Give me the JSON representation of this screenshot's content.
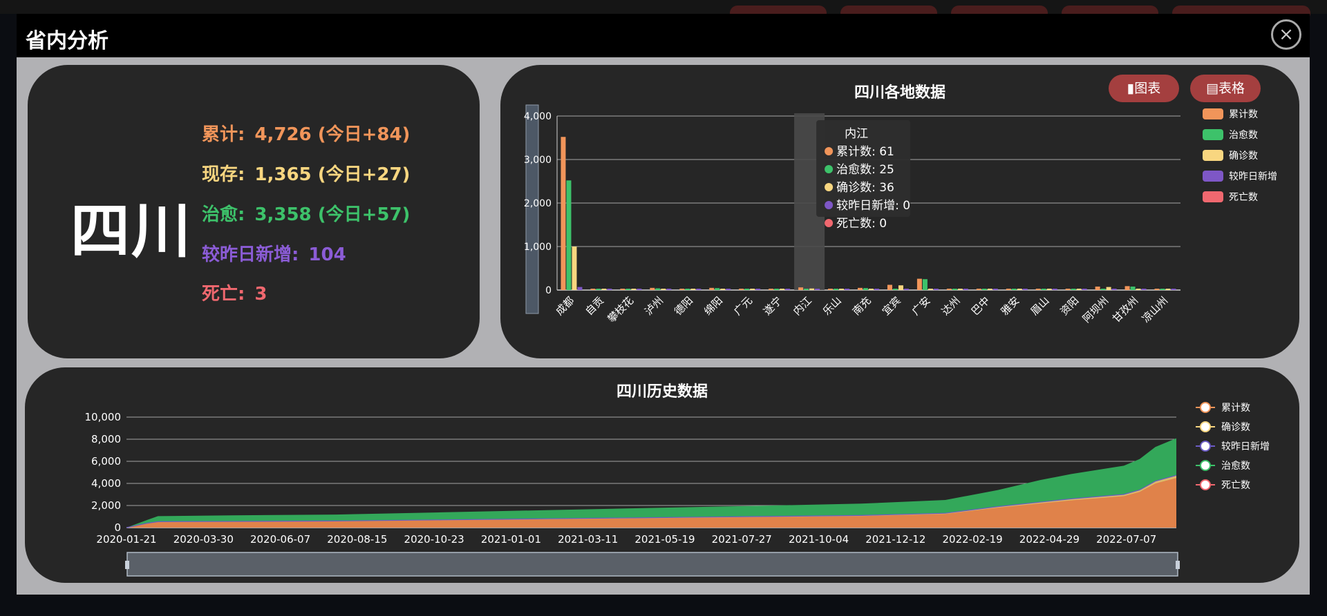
{
  "modal": {
    "title": "省内分析"
  },
  "summary": {
    "province": "四川",
    "stats": [
      {
        "label": "累计:",
        "value": "4,726 (今日+84)",
        "color": "#f1955a"
      },
      {
        "label": "现存:",
        "value": "1,365 (今日+27)",
        "color": "#f8d680"
      },
      {
        "label": "治愈:",
        "value": "3,358 (今日+57)",
        "color": "#3dc26a"
      },
      {
        "label": "较昨日新增:",
        "value": "104",
        "color": "#8b5cd6"
      },
      {
        "label": "死亡:",
        "value": "3",
        "color": "#f0686f"
      }
    ]
  },
  "buttons": {
    "chart": "图表",
    "table": "表格"
  },
  "chart_data": [
    {
      "type": "bar",
      "title": "四川各地数据",
      "categories": [
        "成都",
        "自贡",
        "攀枝花",
        "泸州",
        "德阳",
        "绵阳",
        "广元",
        "遂宁",
        "内江",
        "乐山",
        "南充",
        "宜宾",
        "广安",
        "达州",
        "巴中",
        "雅安",
        "眉山",
        "资阳",
        "阿坝州",
        "甘孜州",
        "凉山州"
      ],
      "series": [
        {
          "name": "累计数",
          "color": "#f1955a",
          "values": [
            3520,
            10,
            16,
            50,
            25,
            50,
            12,
            30,
            61,
            5,
            50,
            120,
            260,
            30,
            25,
            6,
            25,
            30,
            80,
            90,
            30
          ]
        },
        {
          "name": "治愈数",
          "color": "#3dc26a",
          "values": [
            2520,
            6,
            10,
            40,
            20,
            45,
            10,
            25,
            25,
            4,
            45,
            12,
            250,
            25,
            20,
            5,
            20,
            25,
            10,
            80,
            25
          ]
        },
        {
          "name": "确诊数",
          "color": "#f8d680",
          "values": [
            1000,
            4,
            6,
            10,
            5,
            5,
            2,
            5,
            36,
            1,
            5,
            108,
            10,
            5,
            5,
            1,
            5,
            5,
            70,
            10,
            5
          ]
        },
        {
          "name": "较昨日新增",
          "color": "#7e57c6",
          "values": [
            70,
            0,
            0,
            0,
            0,
            0,
            0,
            0,
            0,
            0,
            0,
            0,
            0,
            0,
            0,
            0,
            0,
            0,
            0,
            0,
            0
          ]
        },
        {
          "name": "死亡数",
          "color": "#f0686f",
          "values": [
            0,
            0,
            0,
            0,
            0,
            0,
            0,
            0,
            0,
            0,
            0,
            0,
            0,
            0,
            0,
            0,
            0,
            0,
            0,
            0,
            0
          ]
        }
      ],
      "yticks": [
        "0",
        "1,000",
        "2,000",
        "3,000",
        "4,000"
      ],
      "ylim": [
        0,
        4000
      ],
      "grid": true,
      "legend_position": "right",
      "tooltip": {
        "title": "内江",
        "lines": [
          "累计数: 61",
          "治愈数: 25",
          "确诊数: 36",
          "较昨日新增: 0",
          "死亡数: 0"
        ],
        "category_index": 8
      }
    },
    {
      "type": "area",
      "title": "四川历史数据",
      "series_names": [
        "累计数",
        "确诊数",
        "较昨日新增",
        "治愈数",
        "死亡数"
      ],
      "colors": {
        "cumulative": "#e0824a",
        "confirmed": "#ddba6a",
        "cured": "#33a85a",
        "new": "#6b5bc4"
      },
      "xticks": [
        "2020-01-21",
        "2020-03-30",
        "2020-06-07",
        "2020-08-15",
        "2020-10-23",
        "2021-01-01",
        "2021-03-11",
        "2021-05-19",
        "2021-07-27",
        "2021-10-04",
        "2021-12-12",
        "2022-02-19",
        "2022-04-29",
        "2022-07-07"
      ],
      "yticks": [
        "0",
        "2,000",
        "4,000",
        "6,000",
        "8,000",
        "10,000"
      ],
      "ylim": [
        0,
        10000
      ],
      "points": [
        {
          "t": 0,
          "cum": 0,
          "cured": 0
        },
        {
          "t": 0.02,
          "cum": 400,
          "cured": 300
        },
        {
          "t": 0.03,
          "cum": 540,
          "cured": 500
        },
        {
          "t": 0.1,
          "cum": 560,
          "cured": 550
        },
        {
          "t": 0.2,
          "cum": 600,
          "cured": 580
        },
        {
          "t": 0.3,
          "cum": 700,
          "cured": 680
        },
        {
          "t": 0.4,
          "cum": 800,
          "cured": 780
        },
        {
          "t": 0.5,
          "cum": 900,
          "cured": 880
        },
        {
          "t": 0.6,
          "cum": 1000,
          "cured": 970
        },
        {
          "t": 0.7,
          "cum": 1100,
          "cured": 1070
        },
        {
          "t": 0.78,
          "cum": 1300,
          "cured": 1200
        },
        {
          "t": 0.83,
          "cum": 1900,
          "cured": 1500
        },
        {
          "t": 0.87,
          "cum": 2300,
          "cured": 2000
        },
        {
          "t": 0.9,
          "cum": 2600,
          "cured": 2250
        },
        {
          "t": 0.95,
          "cum": 3000,
          "cured": 2600
        },
        {
          "t": 0.965,
          "cum": 3400,
          "cured": 2800
        },
        {
          "t": 0.98,
          "cum": 4200,
          "cured": 3100
        },
        {
          "t": 1.0,
          "cum": 4726,
          "cured": 3358
        }
      ],
      "legend_position": "right"
    }
  ]
}
